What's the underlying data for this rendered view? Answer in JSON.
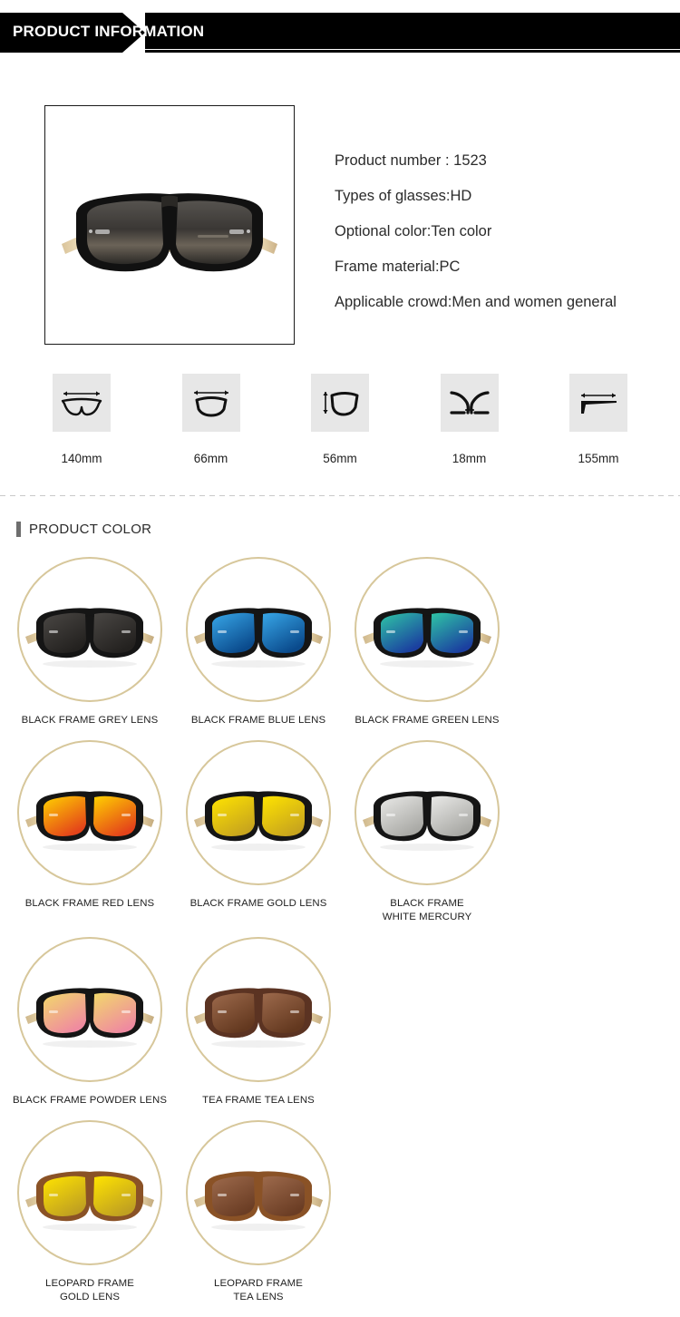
{
  "banner": {
    "title": "PRODUCT INFORMATION"
  },
  "hero": {
    "image_alt": "black-frame-sunglasses-with-bamboo-temples",
    "specs": [
      "Product number : 1523",
      "Types of glasses:HD",
      "Optional color:Ten color",
      "Frame material:PC",
      "Applicable crowd:Men and women general"
    ]
  },
  "measurements": [
    {
      "icon": "lens-width-icon",
      "label": "140mm"
    },
    {
      "icon": "frame-width-icon",
      "label": "66mm"
    },
    {
      "icon": "lens-height-icon",
      "label": "56mm"
    },
    {
      "icon": "bridge-width-icon",
      "label": "18mm"
    },
    {
      "icon": "temple-length-icon",
      "label": "155mm"
    }
  ],
  "color_section": {
    "title": "PRODUCT COLOR",
    "items": [
      {
        "label": "BLACK FRAME GREY LENS",
        "frame": "#151515",
        "lens_a": "#4a4744",
        "lens_b": "#23211f",
        "temple": "#e2cfa4"
      },
      {
        "label": "BLACK FRAME BLUE LENS",
        "frame": "#151515",
        "lens_a": "#38a7e8",
        "lens_b": "#0a4a8c",
        "temple": "#e2cfa4"
      },
      {
        "label": "BLACK FRAME GREEN LENS",
        "frame": "#151515",
        "lens_a": "#2fc6a6",
        "lens_b": "#1b3fa0",
        "temple": "#e2cfa4"
      },
      {
        "label": "BLACK FRAME RED LENS",
        "frame": "#151515",
        "lens_a": "#ffd200",
        "lens_b": "#e4431a",
        "temple": "#e2cfa4"
      },
      {
        "label": "BLACK FRAME GOLD LENS",
        "frame": "#151515",
        "lens_a": "#ffe400",
        "lens_b": "#c8a51d",
        "temple": "#e2cfa4"
      },
      {
        "label": "BLACK FRAME\nWHITE MERCURY",
        "frame": "#151515",
        "lens_a": "#e9e9e7",
        "lens_b": "#a9a9a5",
        "temple": "#e2cfa4"
      },
      {
        "label": "BLACK FRAME POWDER LENS",
        "frame": "#151515",
        "lens_a": "#f2d96a",
        "lens_b": "#ef8aa0",
        "temple": "#e2cfa4"
      },
      {
        "label": "TEA FRAME TEA LENS",
        "frame": "#5b3322",
        "lens_a": "#9d6a4c",
        "lens_b": "#63381f",
        "temple": "#e2cfa4"
      },
      {
        "label": "LEOPARD FRAME\nGOLD LENS",
        "frame": "#8a5226",
        "lens_a": "#ffe400",
        "lens_b": "#c0a021",
        "temple": "#e2cfa4"
      },
      {
        "label": "LEOPARD FRAME\nTEA LENS",
        "frame": "#8a5226",
        "lens_a": "#9d6a4c",
        "lens_b": "#6b3d24",
        "temple": "#e2cfa4"
      }
    ]
  },
  "colors": {
    "banner_bg": "#000000",
    "icon_bg": "#e7e7e7",
    "ring": "#d7c79b",
    "divider": "#c9c9c9",
    "section_bar": "#6e6e6e",
    "text": "#222222"
  }
}
